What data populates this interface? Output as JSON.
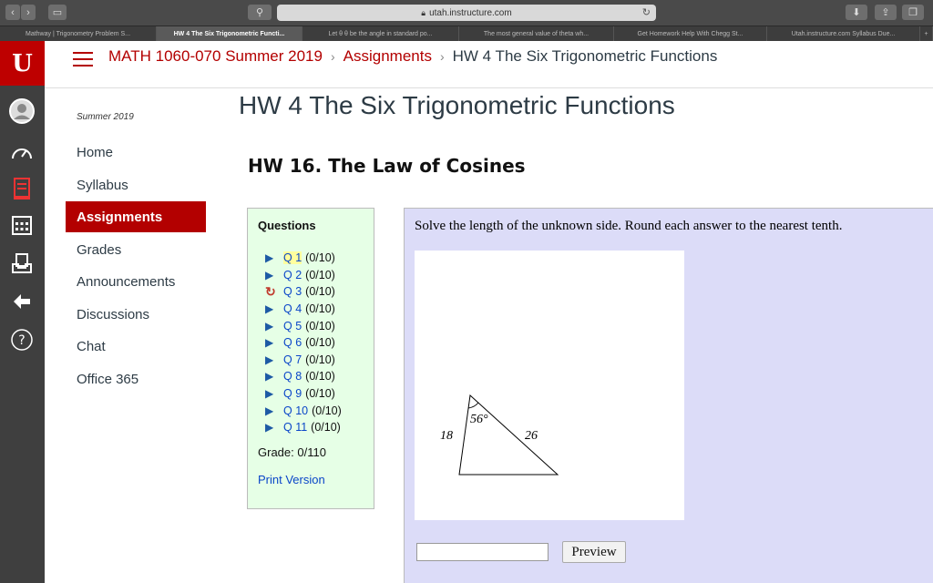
{
  "browser": {
    "url": "utah.instructure.com",
    "tabs": [
      "Mathway | Trigonometry Problem S...",
      "HW 4 The Six Trigonometric Functi...",
      "Let θ θ be the angle in standard po...",
      "The most general value of theta wh...",
      "Get Homework Help With Chegg St...",
      "Utah.instructure.com Syllabus Due..."
    ]
  },
  "global_nav": {
    "logo": "U"
  },
  "breadcrumb": {
    "course": "MATH 1060-070 Summer 2019",
    "section": "Assignments",
    "current": "HW 4 The Six Trigonometric Functions",
    "separator": "›"
  },
  "course_nav": {
    "term": "Summer 2019",
    "items": [
      "Home",
      "Syllabus",
      "Assignments",
      "Grades",
      "Announcements",
      "Discussions",
      "Chat",
      "Office 365"
    ],
    "active": "Assignments"
  },
  "page_title": "HW 4 The Six Trigonometric Functions",
  "hw_title": "HW 16. The Law of Cosines",
  "questions": {
    "heading": "Questions",
    "items": [
      {
        "label": "Q 1",
        "score": "(0/10)",
        "status": "play"
      },
      {
        "label": "Q 2",
        "score": "(0/10)",
        "status": "play"
      },
      {
        "label": "Q 3",
        "score": "(0/10)",
        "status": "retry"
      },
      {
        "label": "Q 4",
        "score": "(0/10)",
        "status": "play"
      },
      {
        "label": "Q 5",
        "score": "(0/10)",
        "status": "play"
      },
      {
        "label": "Q 6",
        "score": "(0/10)",
        "status": "play"
      },
      {
        "label": "Q 7",
        "score": "(0/10)",
        "status": "play"
      },
      {
        "label": "Q 8",
        "score": "(0/10)",
        "status": "play"
      },
      {
        "label": "Q 9",
        "score": "(0/10)",
        "status": "play"
      },
      {
        "label": "Q 10",
        "score": "(0/10)",
        "status": "play"
      },
      {
        "label": "Q 11",
        "score": "(0/10)",
        "status": "play"
      }
    ],
    "current": "Q 1",
    "grade": "Grade: 0/110",
    "print_version": "Print Version"
  },
  "problem": {
    "text": "Solve the length of the unknown side. Round each answer to the nearest tenth.",
    "figure": {
      "side_left": "18",
      "side_right": "26",
      "angle": "56°"
    },
    "answer_value": "",
    "preview_label": "Preview"
  },
  "colors": {
    "accent": "#b30000",
    "link": "#0a46c8",
    "questions_bg": "#e6ffe6",
    "problem_bg": "#dcdcf8"
  }
}
